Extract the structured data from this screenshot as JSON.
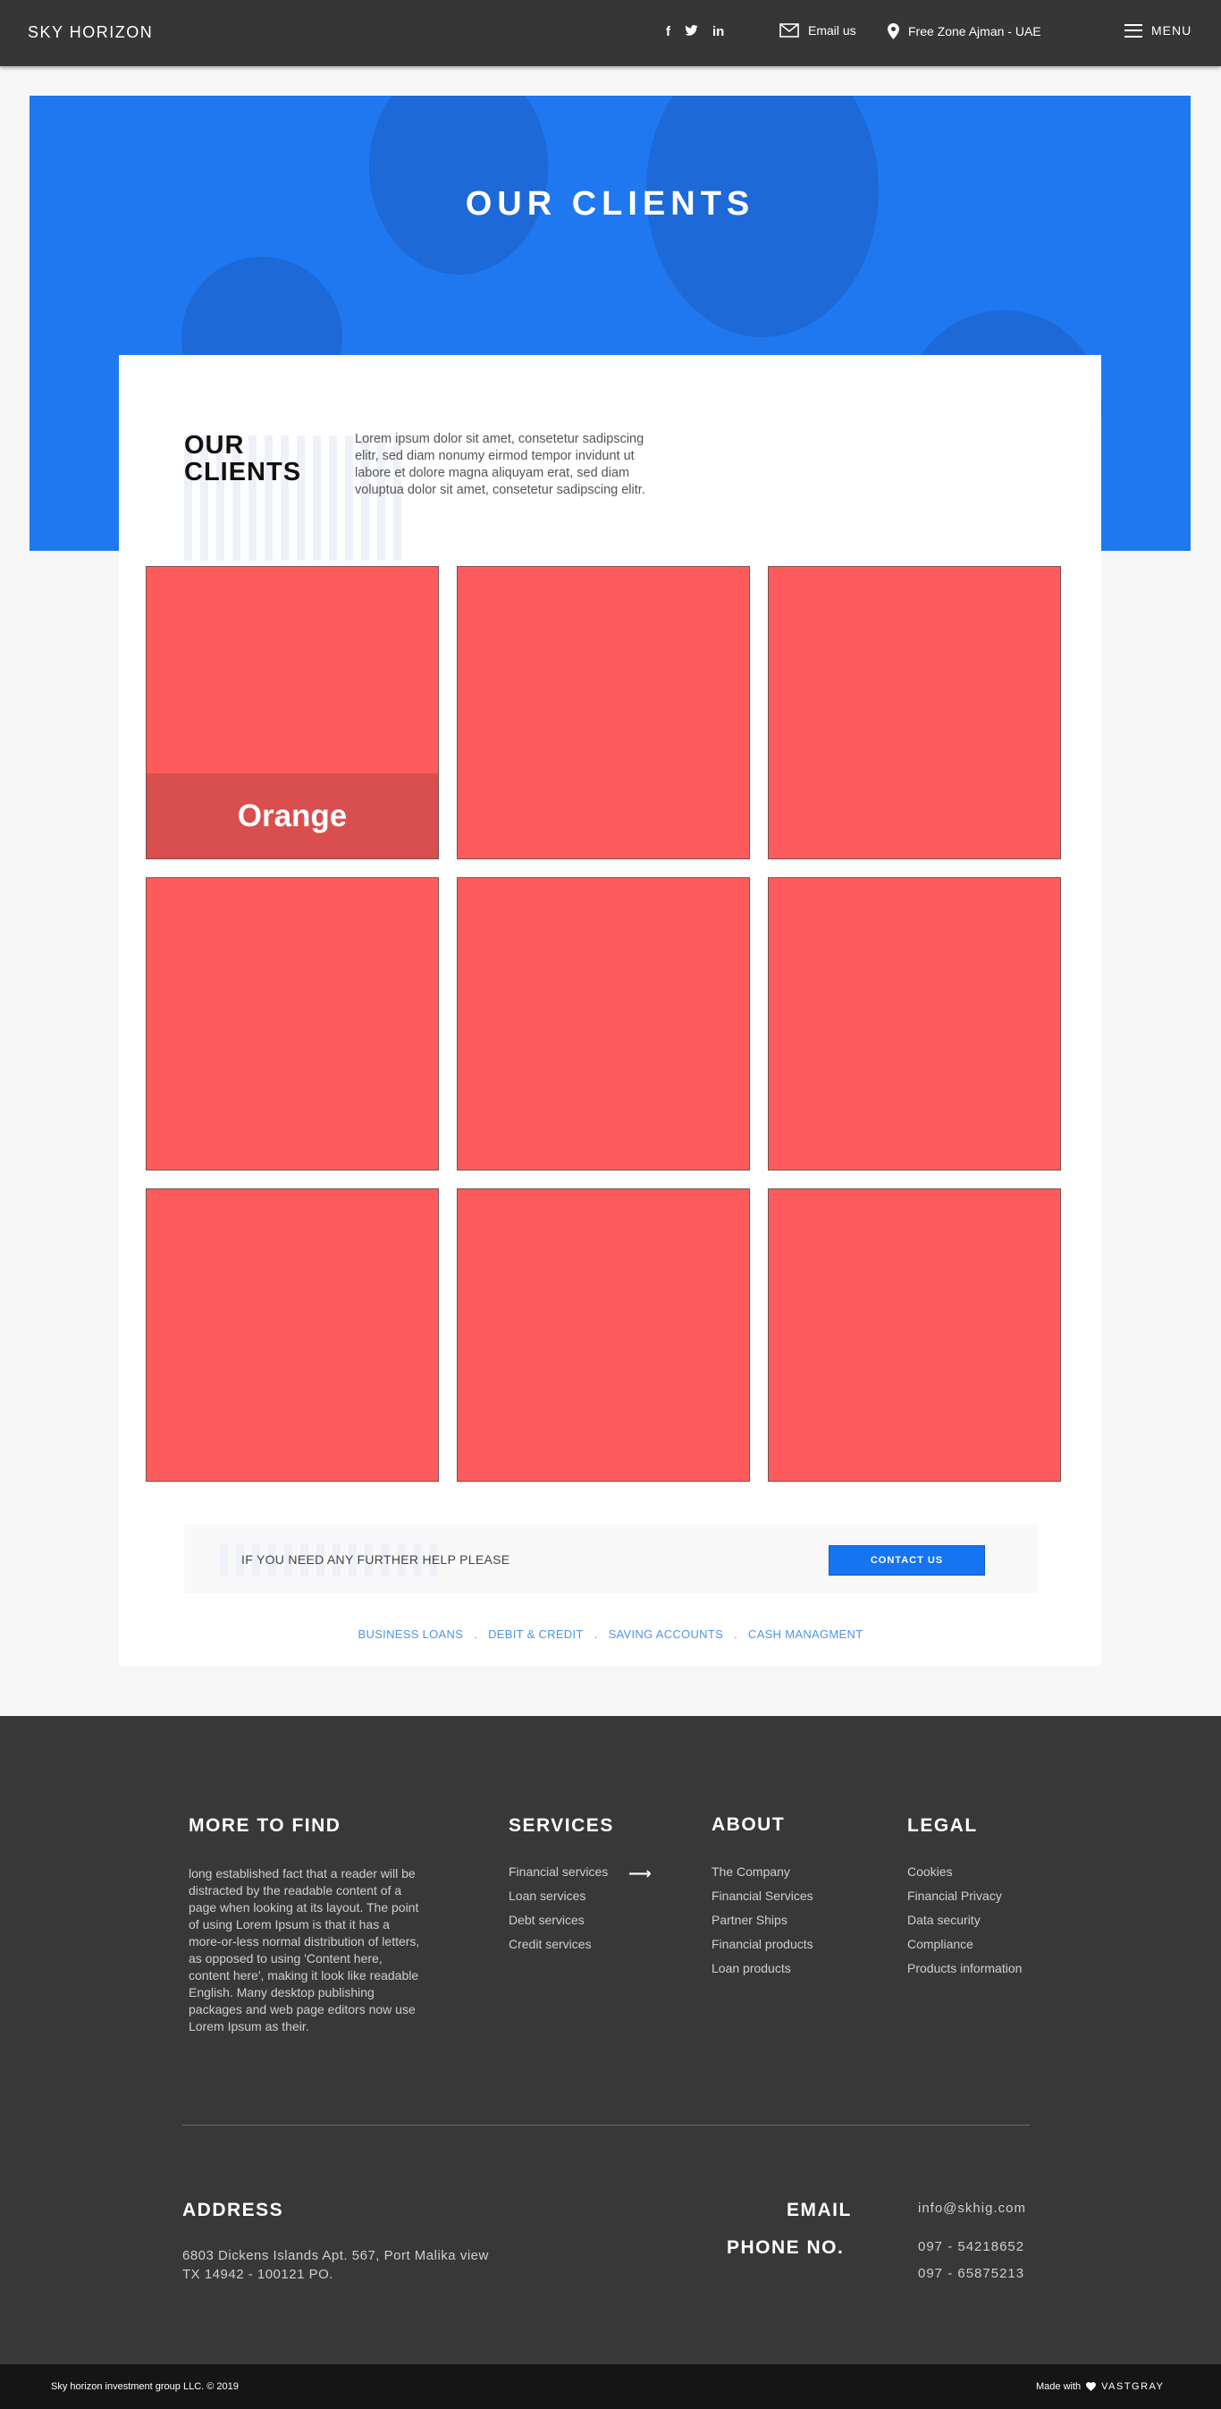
{
  "header": {
    "logo": "SKY HORIZON",
    "social": [
      "f",
      "t",
      "in"
    ],
    "email_label": "Email us",
    "location_label": "Free Zone Ajman - UAE",
    "menu_label": "MENU"
  },
  "hero": {
    "title": "OUR CLIENTS"
  },
  "clients_section": {
    "title_line1": "OUR",
    "title_line2": "CLIENTS",
    "description": "Lorem ipsum dolor sit amet, consetetur sadipscing elitr, sed diam nonumy eirmod tempor invidunt ut labore et dolore magna aliquyam erat, sed diam voluptua dolor sit amet, consetetur sadipscing elitr.",
    "tiles": [
      {
        "caption": "Orange"
      },
      {
        "caption": ""
      },
      {
        "caption": ""
      },
      {
        "caption": ""
      },
      {
        "caption": ""
      },
      {
        "caption": ""
      },
      {
        "caption": ""
      },
      {
        "caption": ""
      },
      {
        "caption": ""
      }
    ],
    "tile_color": "#fe5c5c"
  },
  "help": {
    "text": "IF YOU NEED ANY FURTHER HELP PLEASE",
    "button_label": "CONTACT US"
  },
  "service_links": [
    "BUSINESS LOANS",
    "DEBIT & CREDIT",
    "SAVING ACCOUNTS",
    "CASH MANAGMENT"
  ],
  "footer": {
    "more": {
      "heading": "MORE TO FIND",
      "text": "long established fact that a reader will be distracted by the readable content of a page when looking at its layout. The point of using Lorem Ipsum is that it has a more-or-less normal distribution of letters, as opposed to using 'Content here, content here', making it look like readable English. Many desktop publishing packages and web page editors now use Lorem Ipsum as their."
    },
    "services": {
      "heading": "SERVICES",
      "items": [
        "Financial services",
        "Loan services",
        "Debt services",
        "Credit services"
      ]
    },
    "about": {
      "heading": "ABOUT",
      "items": [
        "The Company",
        "Financial Services",
        "Partner Ships",
        "Financial products",
        "Loan products"
      ]
    },
    "legal": {
      "heading": "LEGAL",
      "items": [
        "Cookies",
        "Financial Privacy",
        "Data security",
        "Compliance",
        "Products information"
      ]
    },
    "address": {
      "heading": "ADDRESS",
      "line1": "6803 Dickens Islands Apt. 567, Port Malika view",
      "line2": "TX 14942 - 100121 PO."
    },
    "email": {
      "heading": "EMAIL",
      "value": "info@skhig.com"
    },
    "phone": {
      "heading": "PHONE NO.",
      "value1": "097 - 54218652",
      "value2": "097 - 65875213"
    }
  },
  "bottom_bar": {
    "copyright": "Sky horizon investment group LLC.  © 2019",
    "made_with": "Made with",
    "brand": "VASTGRAY"
  },
  "colors": {
    "header_bg": "#363636",
    "hero_blue": "#2078f0",
    "accent_button": "#1674f1",
    "link_blue": "#4e94e6",
    "footer_bg": "#383838",
    "bottom_bg": "#151515"
  }
}
